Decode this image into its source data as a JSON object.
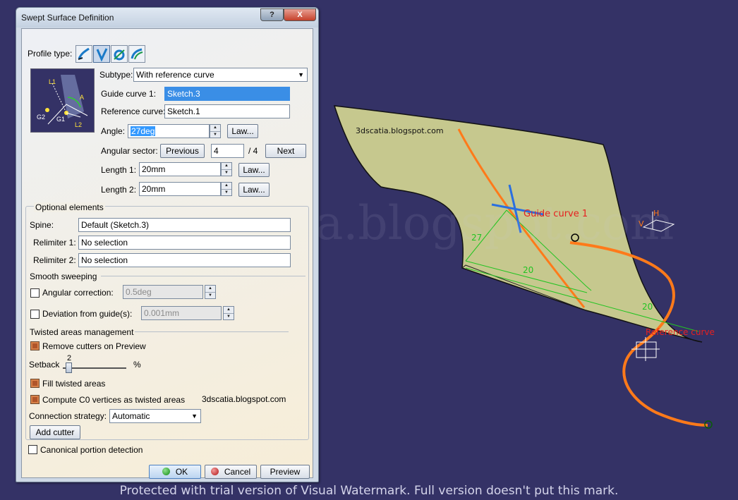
{
  "dialog": {
    "title": "Swept Surface Definition",
    "help_button": "?",
    "close_button": "X",
    "profile_type_label": "Profile type:",
    "profile_type_icons": [
      "explicit-profile-icon",
      "line-profile-icon",
      "circle-profile-icon",
      "conic-profile-icon"
    ],
    "preview_labels": [
      "L1",
      "A",
      "G2",
      "G1",
      "L2"
    ],
    "subtype": {
      "label": "Subtype:",
      "value": "With reference curve"
    },
    "guide_curve_1": {
      "label": "Guide curve 1:",
      "value": "Sketch.3"
    },
    "reference_curve": {
      "label": "Reference curve:",
      "value": "Sketch.1"
    },
    "angle": {
      "label": "Angle:",
      "value": "27deg",
      "law_button": "Law..."
    },
    "angular_sector": {
      "label": "Angular sector:",
      "previous_button": "Previous",
      "value": "4",
      "total": "/ 4",
      "next_button": "Next"
    },
    "length_1": {
      "label": "Length 1:",
      "value": "20mm",
      "law_button": "Law..."
    },
    "length_2": {
      "label": "Length 2:",
      "value": "20mm",
      "law_button": "Law..."
    },
    "optional_elements": {
      "title": "Optional elements",
      "spine": {
        "label": "Spine:",
        "value": "Default (Sketch.3)"
      },
      "relimiter_1": {
        "label": "Relimiter 1:",
        "value": "No selection"
      },
      "relimiter_2": {
        "label": "Relimiter 2:",
        "value": "No selection"
      }
    },
    "smooth_sweeping": {
      "title": "Smooth sweeping",
      "angular_correction": {
        "label": "Angular correction:",
        "value": "0.5deg",
        "checked": false
      },
      "deviation_from_guides": {
        "label": "Deviation from guide(s):",
        "value": "0.001mm",
        "checked": false
      }
    },
    "twisted_areas": {
      "title": "Twisted areas management",
      "remove_cutters": {
        "label": "Remove cutters on Preview",
        "checked": true
      },
      "setback": {
        "label": "Setback",
        "value": "2",
        "unit": "%"
      },
      "fill_twisted": {
        "label": "Fill twisted areas",
        "checked": true
      },
      "compute_c0": {
        "label": "Compute C0 vertices as twisted areas",
        "checked": true
      },
      "blog_text": "3dscatia.blogspot.com",
      "connection_strategy": {
        "label": "Connection strategy:",
        "value": "Automatic"
      },
      "add_cutter_button": "Add cutter"
    },
    "canonical_portion": {
      "label": "Canonical portion detection",
      "checked": false
    },
    "ok_button": "OK",
    "cancel_button": "Cancel",
    "preview_button": "Preview"
  },
  "viewport": {
    "blog_label": "3dscatia.blogspot.com",
    "big_watermark": "3dscatia.blogspot.com",
    "guide_curve_label": "Guide curve 1",
    "reference_curve_label": "Reference curve",
    "dim_angle": "27",
    "dim_length_a": "20",
    "dim_length_b": "20",
    "axis_h": "H",
    "axis_v": "V"
  },
  "watermark_banner": "Protected with trial version of Visual Watermark. Full version doesn't put this mark.",
  "colors": {
    "background": "#343266",
    "surface": "#c6c88e",
    "curve": "#ff7a1a",
    "dimension": "#22c422",
    "label_red": "#e62020"
  }
}
